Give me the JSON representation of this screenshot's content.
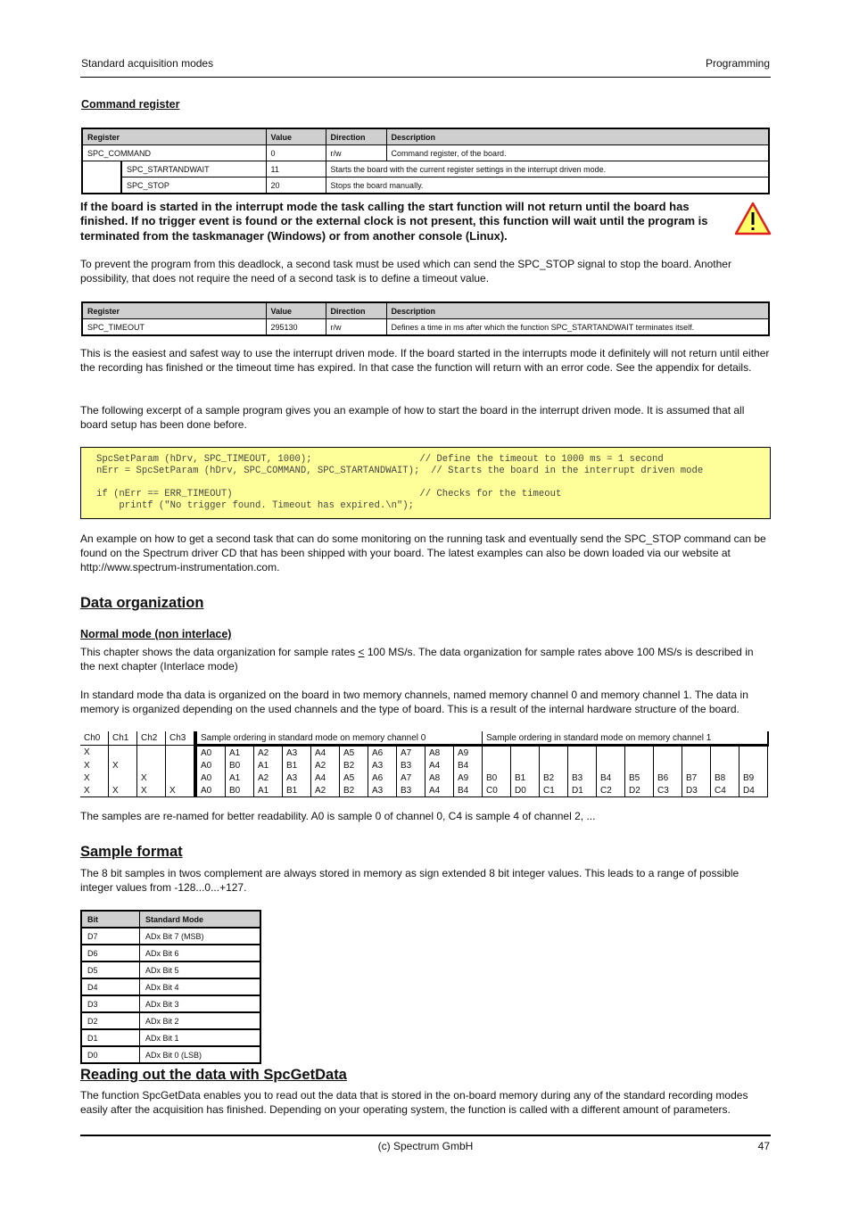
{
  "header": {
    "left": "Standard acquisition modes",
    "right": "Programming"
  },
  "command_register": {
    "title": "Command register",
    "columns": [
      "Register",
      "Value",
      "Direction",
      "Description"
    ],
    "rows": [
      {
        "register": "SPC_COMMAND",
        "value": "0",
        "direction": "r/w",
        "description": "Command register, of the board."
      },
      {
        "register": "SPC_STARTANDWAIT",
        "value": "11",
        "description": "Starts the board with the current register settings in the interrupt driven mode."
      },
      {
        "register": "SPC_STOP",
        "value": "20",
        "description": "Stops the board manually."
      }
    ]
  },
  "warning": {
    "icon": "warning-triangle-icon",
    "text": "If the board is started in the interrupt mode  the task calling the start function will not return until the board has finished. If no trigger event is found or the external clock is not present, this function will wait until the program is terminated from the taskmanager (Windows) or from another console (Linux)."
  },
  "para_deadlock": "To prevent the program from this deadlock, a second task must be used which can send the SPC_STOP signal to stop the board. Another possibility, that does not require the need of a second task is to define a timeout value.",
  "timeout_register": {
    "columns": [
      "Register",
      "Value",
      "Direction",
      "Description"
    ],
    "rows": [
      {
        "register": "SPC_TIMEOUT",
        "value": "295130",
        "direction": "r/w",
        "description": "Defines a time in ms after which the function SPC_STARTANDWAIT terminates itself."
      }
    ]
  },
  "para_easiest": "This is the easiest and safest way to use the interrupt driven mode. If the board started in the interrupts mode it definitely will not return until either the recording has finished or the timeout time has expired. In that case the function will return with an error code. See the appendix for details.",
  "para_excerpt": "The following excerpt of a sample program gives you an example of how to start the board in the interrupt driven mode. It is assumed that all board setup has been done before.",
  "code": {
    "lines": [
      "SpcSetParam (hDrv, SPC_TIMEOUT, 1000);                   // Define the timeout to 1000 ms = 1 second",
      "nErr = SpcSetParam (hDrv, SPC_COMMAND, SPC_STARTANDWAIT);  // Starts the board in the interrupt driven mode",
      "",
      "if (nErr == ERR_TIMEOUT)                                 // Checks for the timeout",
      "    printf (\"No trigger found. Timeout has expired.\\n\");"
    ]
  },
  "para_example": "An example on how to get a second task that can do some monitoring on the running task and eventually send the SPC_STOP command can be found on the Spectrum driver CD that has been shipped with your board. The latest examples can also be down loaded via our website at http://www.spectrum-instrumentation.com.",
  "data_organization": {
    "title": "Data organization",
    "normal_mode_title": "Normal mode (non interlace)",
    "para_rates_a": "This chapter shows the data organization for sample rates ",
    "para_rates_le": "<",
    "para_rates_b": " 100 MS/s. The data organization for sample rates above 100 MS/s is described in the next chapter (Interlace mode)",
    "para_standard": "In standard mode tha data is organized on the board in two memory channels, named memory channel 0 and memory channel 1. The data in memory is organized depending on the used channels and the type of board. This is a result of the internal hardware structure of the board.",
    "table": {
      "channel_headers": [
        "Ch0",
        "Ch1",
        "Ch2",
        "Ch3"
      ],
      "mem0_header": "Sample ordering in standard mode on memory channel 0",
      "mem1_header": "Sample ordering in standard mode on memory channel 1",
      "rows": [
        {
          "ch": [
            "X",
            "",
            "",
            ""
          ],
          "mem0": [
            "A0",
            "A1",
            "A2",
            "A3",
            "A4",
            "A5",
            "A6",
            "A7",
            "A8",
            "A9"
          ],
          "mem1": [
            "",
            "",
            "",
            "",
            "",
            "",
            "",
            "",
            "",
            ""
          ]
        },
        {
          "ch": [
            "X",
            "X",
            "",
            ""
          ],
          "mem0": [
            "A0",
            "B0",
            "A1",
            "B1",
            "A2",
            "B2",
            "A3",
            "B3",
            "A4",
            "B4"
          ],
          "mem1": [
            "",
            "",
            "",
            "",
            "",
            "",
            "",
            "",
            "",
            ""
          ]
        },
        {
          "ch": [
            "X",
            "",
            "X",
            ""
          ],
          "mem0": [
            "A0",
            "A1",
            "A2",
            "A3",
            "A4",
            "A5",
            "A6",
            "A7",
            "A8",
            "A9"
          ],
          "mem1": [
            "B0",
            "B1",
            "B2",
            "B3",
            "B4",
            "B5",
            "B6",
            "B7",
            "B8",
            "B9"
          ]
        },
        {
          "ch": [
            "X",
            "X",
            "X",
            "X"
          ],
          "mem0": [
            "A0",
            "B0",
            "A1",
            "B1",
            "A2",
            "B2",
            "A3",
            "B3",
            "A4",
            "B4"
          ],
          "mem1": [
            "C0",
            "D0",
            "C1",
            "D1",
            "C2",
            "D2",
            "C3",
            "D3",
            "C4",
            "D4"
          ]
        }
      ]
    },
    "para_renamed": "The samples are re-named for better readability. A0 is sample 0 of channel 0, C4 is sample 4 of channel 2, ..."
  },
  "sample_format": {
    "title": "Sample format",
    "para": "The 8 bit samples in twos complement are always stored in memory as sign extended 8 bit integer values. This leads to a range of possible integer values from -128...0...+127.",
    "columns": [
      "Bit",
      "Standard Mode"
    ],
    "rows": [
      [
        "D7",
        "ADx Bit 7 (MSB)"
      ],
      [
        "D6",
        "ADx Bit 6"
      ],
      [
        "D5",
        "ADx Bit 5"
      ],
      [
        "D4",
        "ADx Bit 4"
      ],
      [
        "D3",
        "ADx Bit 3"
      ],
      [
        "D2",
        "ADx Bit 2"
      ],
      [
        "D1",
        "ADx Bit 1"
      ],
      [
        "D0",
        "ADx Bit 0 (LSB)"
      ]
    ]
  },
  "reading_out": {
    "title": "Reading out the data with SpcGetData",
    "para": "The function SpcGetData enables you to read out the data that is stored in the on-board memory during any of the standard recording modes easily after the acquisition has finished. Depending on your operating system, the function is called with a different amount of parameters."
  },
  "footer": {
    "center": "(c) Spectrum GmbH",
    "page_number": "47"
  }
}
